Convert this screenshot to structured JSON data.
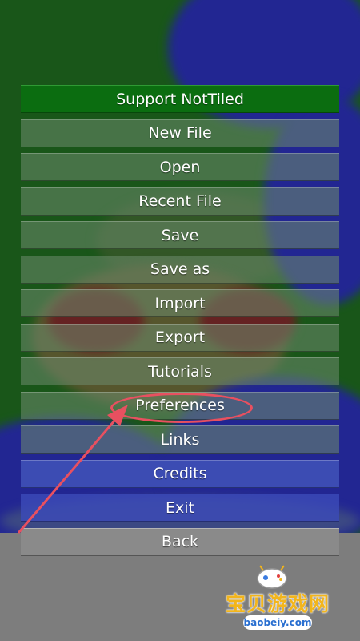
{
  "menu": {
    "items": [
      {
        "label": "Support NotTiled"
      },
      {
        "label": "New File"
      },
      {
        "label": "Open"
      },
      {
        "label": "Recent File"
      },
      {
        "label": "Save"
      },
      {
        "label": "Save as"
      },
      {
        "label": "Import"
      },
      {
        "label": "Export"
      },
      {
        "label": "Tutorials"
      },
      {
        "label": "Preferences"
      },
      {
        "label": "Links"
      },
      {
        "label": "Credits"
      },
      {
        "label": "Exit"
      },
      {
        "label": "Back"
      }
    ]
  },
  "annotation": {
    "color": "#e85060",
    "target": "Preferences"
  },
  "watermark": {
    "title": "宝贝游戏网",
    "subtitle": "baobeiy.com",
    "color": "#f2b51c"
  }
}
